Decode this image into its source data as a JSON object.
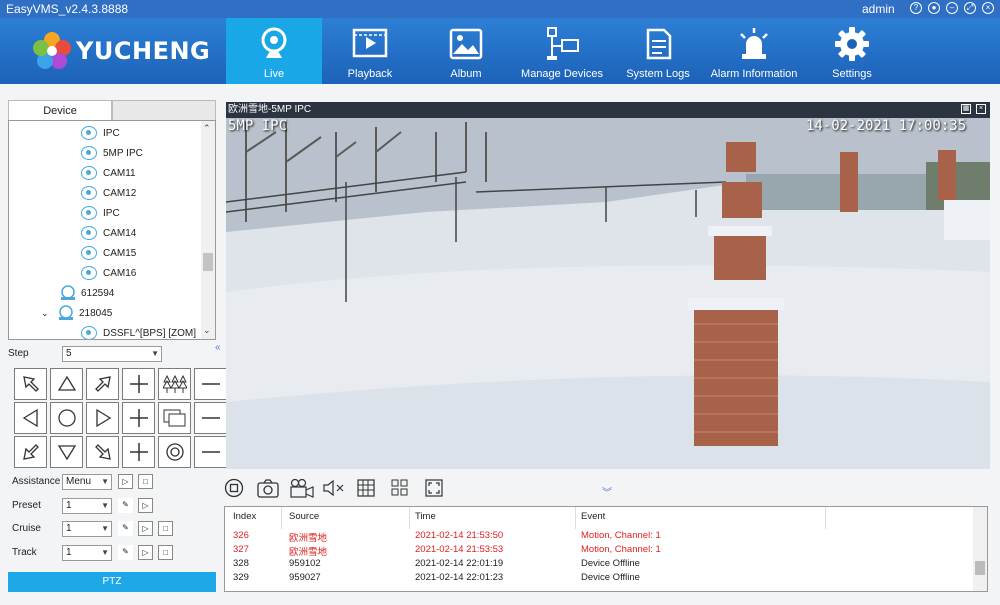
{
  "window": {
    "title": "EasyVMS_v2.4.3.8888",
    "user": "admin",
    "controls": [
      "help-icon",
      "user-icon",
      "minimize-icon",
      "maximize-icon",
      "close-icon"
    ]
  },
  "brand": {
    "logo_text": "YUCHENG"
  },
  "nav": [
    {
      "label": "Live",
      "icon": "webcam-icon",
      "active": true
    },
    {
      "label": "Playback",
      "icon": "film-play-icon"
    },
    {
      "label": "Album",
      "icon": "image-icon"
    },
    {
      "label": "Manage Devices",
      "icon": "devices-icon"
    },
    {
      "label": "System Logs",
      "icon": "document-icon"
    },
    {
      "label": "Alarm Information",
      "icon": "alarm-light-icon"
    },
    {
      "label": "Settings",
      "icon": "gear-icon"
    }
  ],
  "sidebar": {
    "tab": "Device",
    "tree": [
      {
        "label": "IPC",
        "type": "camera"
      },
      {
        "label": "5MP IPC",
        "type": "camera"
      },
      {
        "label": "CAM11",
        "type": "camera"
      },
      {
        "label": "CAM12",
        "type": "camera"
      },
      {
        "label": "IPC",
        "type": "camera"
      },
      {
        "label": "CAM14",
        "type": "camera"
      },
      {
        "label": "CAM15",
        "type": "camera"
      },
      {
        "label": "CAM16",
        "type": "camera"
      },
      {
        "label": "612594",
        "type": "device"
      },
      {
        "label": "218045",
        "type": "device",
        "expanded": true
      },
      {
        "label": "DSSFL^[BPS] [ZOM]",
        "type": "camera"
      }
    ],
    "step_label": "Step",
    "step_value": "5",
    "assistance_label": "Assistance",
    "assistance_value": "Menu",
    "preset_label": "Preset",
    "preset_value": "1",
    "cruise_label": "Cruise",
    "cruise_value": "1",
    "track_label": "Track",
    "track_value": "1",
    "ptz_label": "PTZ",
    "collapse_glyph": "«"
  },
  "video": {
    "title": "欧洲雪地-5MP IPC",
    "osd_name": "5MP IPC",
    "osd_time": "14-02-2021 17:00:35"
  },
  "toolbar": {
    "tools": [
      "stop-icon",
      "snapshot-icon",
      "record-icon",
      "mute-icon",
      "grid-icon",
      "layout-icon",
      "fullscreen-icon"
    ],
    "expand_glyph": "︾"
  },
  "events": {
    "headers": {
      "index": "Index",
      "source": "Source",
      "time": "Time",
      "event": "Event"
    },
    "rows": [
      {
        "index": "326",
        "source": "欧洲雪地",
        "time": "2021-02-14 21:53:50",
        "event": "Motion, Channel: 1",
        "alarm": true
      },
      {
        "index": "327",
        "source": "欧洲雪地",
        "time": "2021-02-14 21:53:53",
        "event": "Motion, Channel: 1",
        "alarm": true
      },
      {
        "index": "328",
        "source": "959102",
        "time": "2021-02-14 22:01:19",
        "event": "Device Offline",
        "alarm": false
      },
      {
        "index": "329",
        "source": "959027",
        "time": "2021-02-14 22:01:23",
        "event": "Device Offline",
        "alarm": false
      }
    ]
  },
  "colors": {
    "nav_bg": "#1c62b8",
    "active_tab": "#1aa7e8",
    "alarm_text": "#e02020"
  }
}
